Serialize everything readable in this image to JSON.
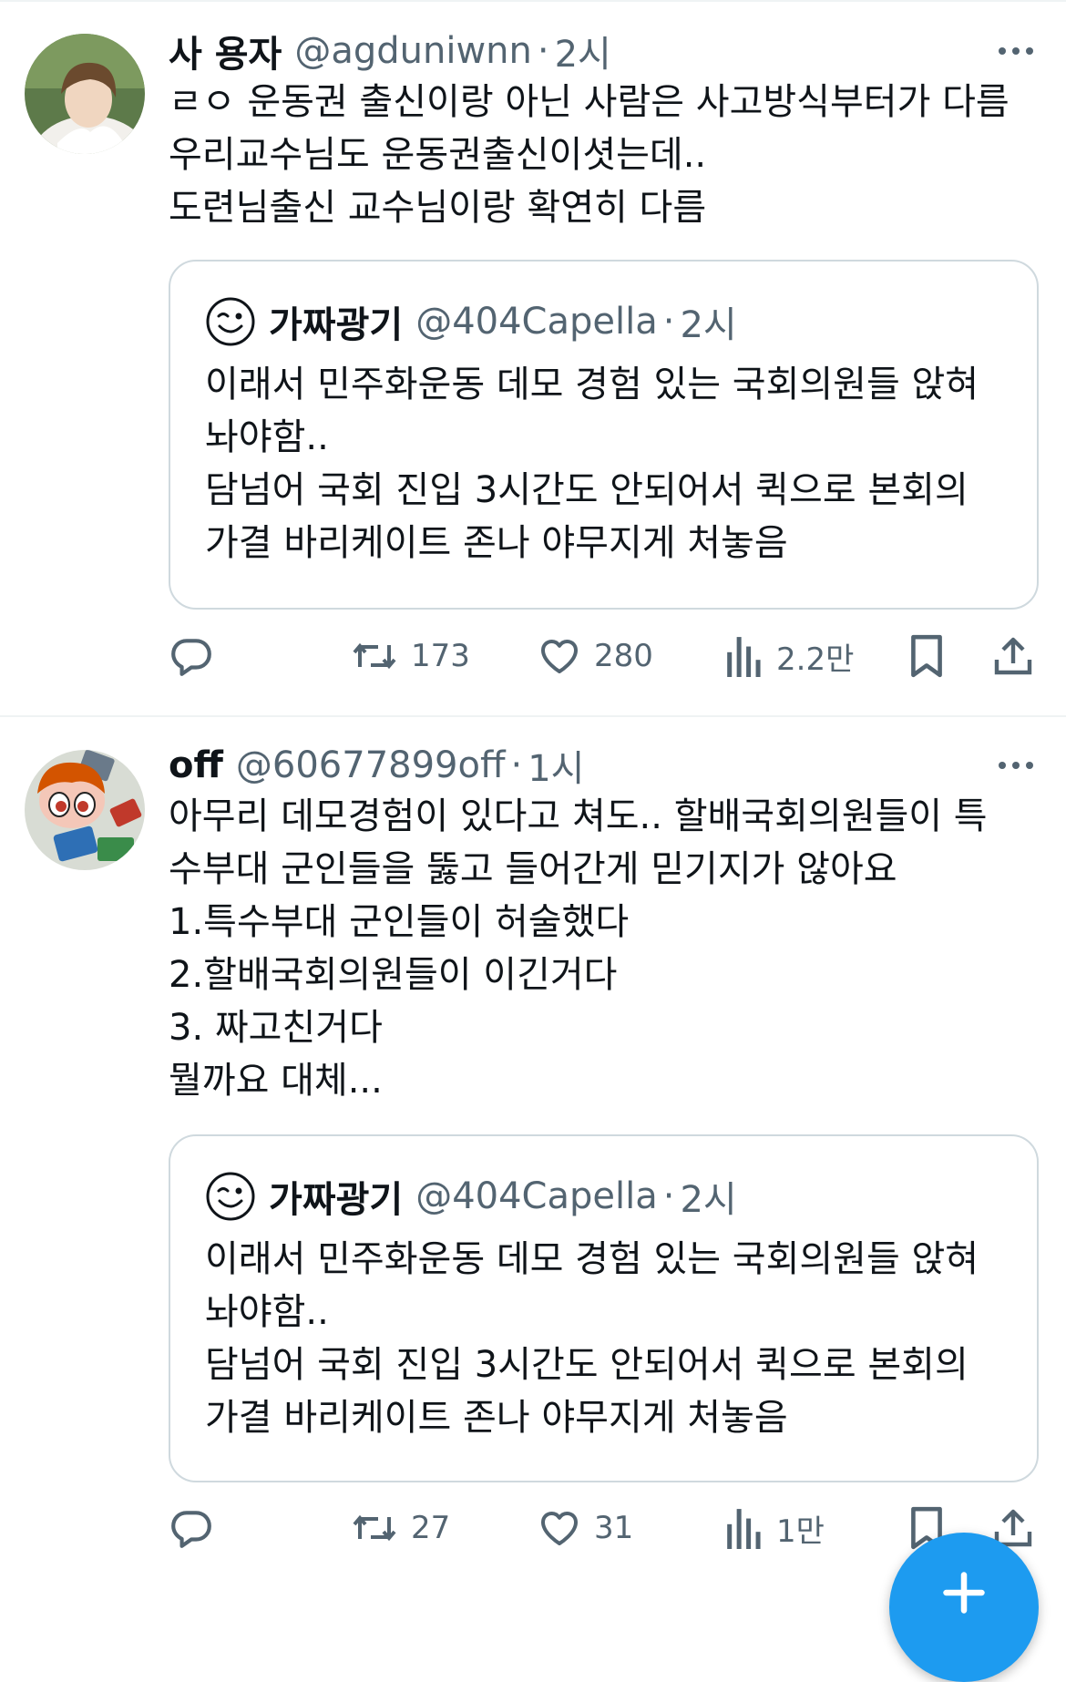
{
  "tweets": [
    {
      "name": "사 용자",
      "handle": "@agduniwnn",
      "separator": "·",
      "time": "2시",
      "lines": [
        "ㄹㅇ 운동권 출신이랑 아닌 사람은 사고방식부터가 다름",
        "우리교수님도 운동권출신이셧는데..",
        "도련님출신 교수님이랑 확연히 다름"
      ],
      "quote": {
        "name": "가짜광기",
        "handle": "@404Capella",
        "separator": "·",
        "time": "2시",
        "lines": [
          "이래서 민주화운동 데모 경험 있는 국회의원들 앉혀",
          "놔야함..",
          "담넘어 국회 진입 3시간도 안되어서 퀵으로 본회의",
          "가결 바리케이트 존나 야무지게 처놓음"
        ]
      },
      "stats": {
        "retweets": "173",
        "likes": "280",
        "views": "2.2만"
      }
    },
    {
      "name": "off",
      "handle": "@60677899off",
      "separator": "·",
      "time": "1시",
      "lines": [
        "아무리 데모경험이 있다고 쳐도.. 할배국회의원들이 특",
        "수부대 군인들을 뚫고 들어간게 믿기지가 않아요",
        "1.특수부대 군인들이 허술했다",
        "2.할배국회의원들이 이긴거다",
        "3. 짜고친거다",
        "뭘까요 대체..."
      ],
      "quote": {
        "name": "가짜광기",
        "handle": "@404Capella",
        "separator": "·",
        "time": "2시",
        "lines": [
          "이래서 민주화운동 데모 경험 있는 국회의원들 앉혀",
          "놔야함..",
          "담넘어 국회 진입 3시간도 안되어서 퀵으로 본회의",
          "가결 바리케이트 존나 야무지게 처놓음"
        ]
      },
      "stats": {
        "retweets": "27",
        "likes": "31",
        "views": "1만"
      }
    }
  ],
  "icons": {
    "reply": "reply-icon",
    "retweet": "retweet-icon",
    "like": "heart-icon",
    "views": "views-icon",
    "bookmark": "bookmark-icon",
    "share": "share-icon",
    "more": "more-icon",
    "compose": "compose-plus-icon",
    "quote_avatar": "winking-face-icon"
  },
  "colors": {
    "text": "#0f1419",
    "muted": "#536471",
    "border": "#cfd9de",
    "accent": "#1d9bf0"
  }
}
